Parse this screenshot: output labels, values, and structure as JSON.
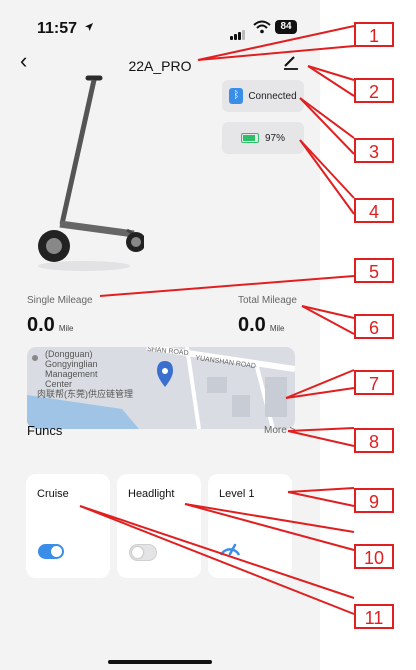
{
  "status": {
    "time": "11:57",
    "battery": "84"
  },
  "nav": {
    "title": "22A_PRO"
  },
  "device": {
    "connection_label": "Connected",
    "battery_label": "97%",
    "battery_level": 0.97
  },
  "mileage": {
    "single_label": "Single Mileage",
    "single_value": "0.0",
    "single_unit": "Mile",
    "total_label": "Total Mileage",
    "total_value": "0.0",
    "total_unit": "Mile"
  },
  "map": {
    "place_line1": "(Dongguan)",
    "place_line2": "Gongyinglian",
    "place_line3": "Management",
    "place_line4": "Center",
    "place_line5": "肉联帮(东莞)供应链管理",
    "road1": "SHAN ROAD",
    "road2": "YUANSHAN ROAD"
  },
  "funcs": {
    "title": "Funcs",
    "more": "More >",
    "cards": [
      {
        "label": "Cruise",
        "on": true
      },
      {
        "label": "Headlight",
        "on": false
      },
      {
        "label": "Level 1"
      }
    ]
  },
  "callouts": [
    "1",
    "2",
    "3",
    "4",
    "5",
    "6",
    "7",
    "8",
    "9",
    "10",
    "11"
  ],
  "colors": {
    "accent": "#3a8ee8",
    "callout": "#e02020",
    "battery": "#2fbf6a"
  }
}
